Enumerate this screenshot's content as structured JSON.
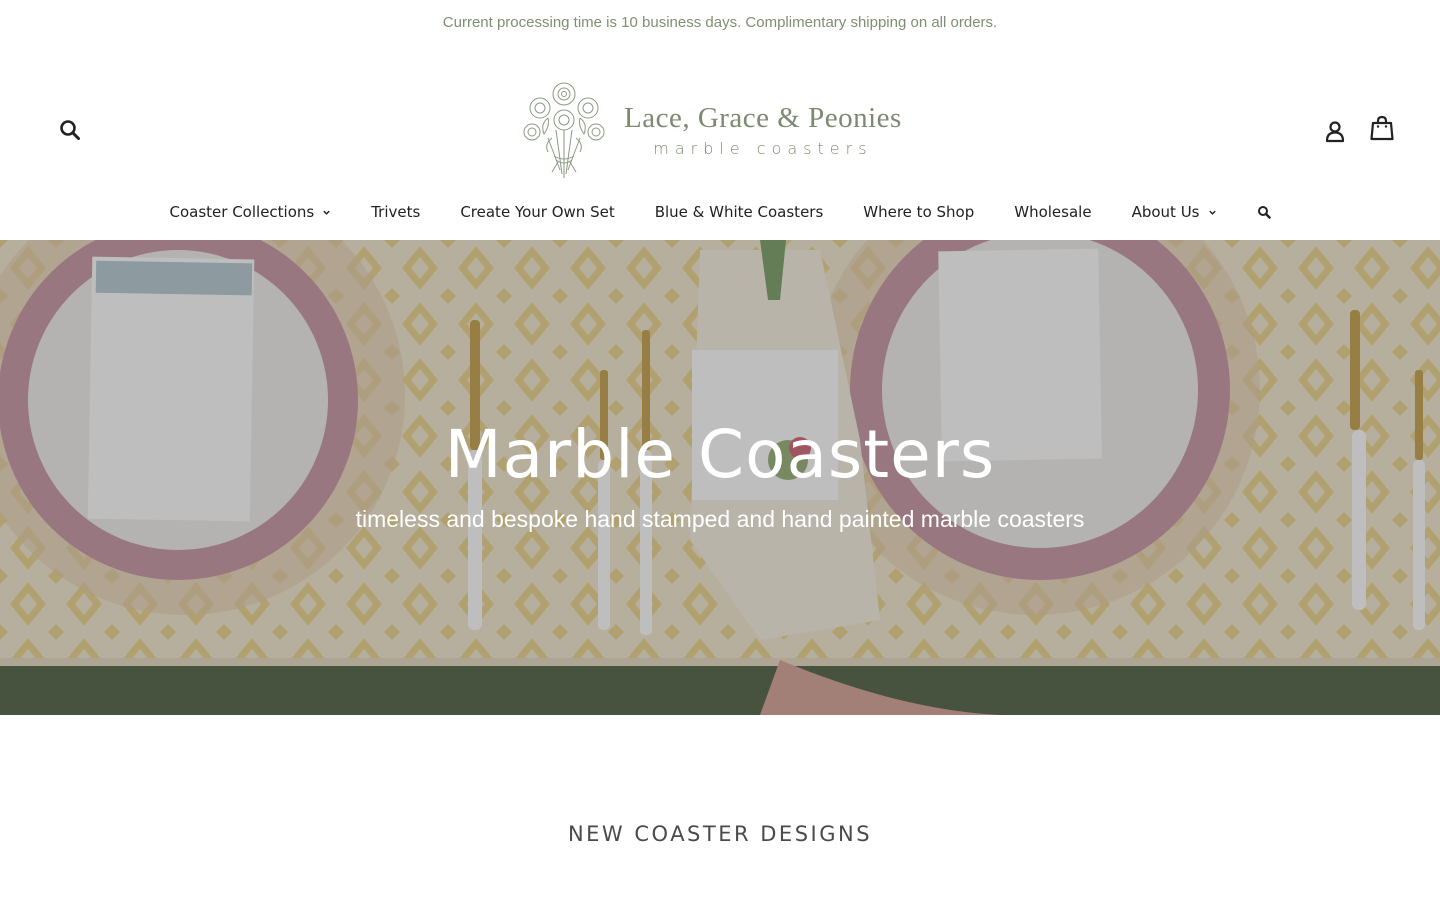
{
  "announcement": {
    "text": "Current processing time is 10 business days. Complimentary shipping on all orders."
  },
  "header": {
    "brand": {
      "name": "Lace, Grace & Peonies",
      "tagline": "marble coasters"
    },
    "icons": {
      "search": "search-icon",
      "login": "user-icon",
      "cart": "shopping-bag-icon"
    }
  },
  "nav": {
    "items": [
      {
        "label": "Coaster Collections",
        "dropdown": true
      },
      {
        "label": "Trivets",
        "dropdown": false
      },
      {
        "label": "Create Your Own Set",
        "dropdown": false
      },
      {
        "label": "Blue & White Coasters",
        "dropdown": false
      },
      {
        "label": "Where to Shop",
        "dropdown": false
      },
      {
        "label": "Wholesale",
        "dropdown": false
      },
      {
        "label": "About Us",
        "dropdown": true
      }
    ]
  },
  "hero": {
    "title": "Marble Coasters",
    "subtitle": "timeless and bespoke hand stamped and hand painted marble coasters"
  },
  "featured": {
    "heading": "NEW COASTER DESIGNS"
  },
  "colors": {
    "announcement_text": "#7f8f72",
    "brand": "#7d8a72",
    "nav_text": "#222222"
  }
}
